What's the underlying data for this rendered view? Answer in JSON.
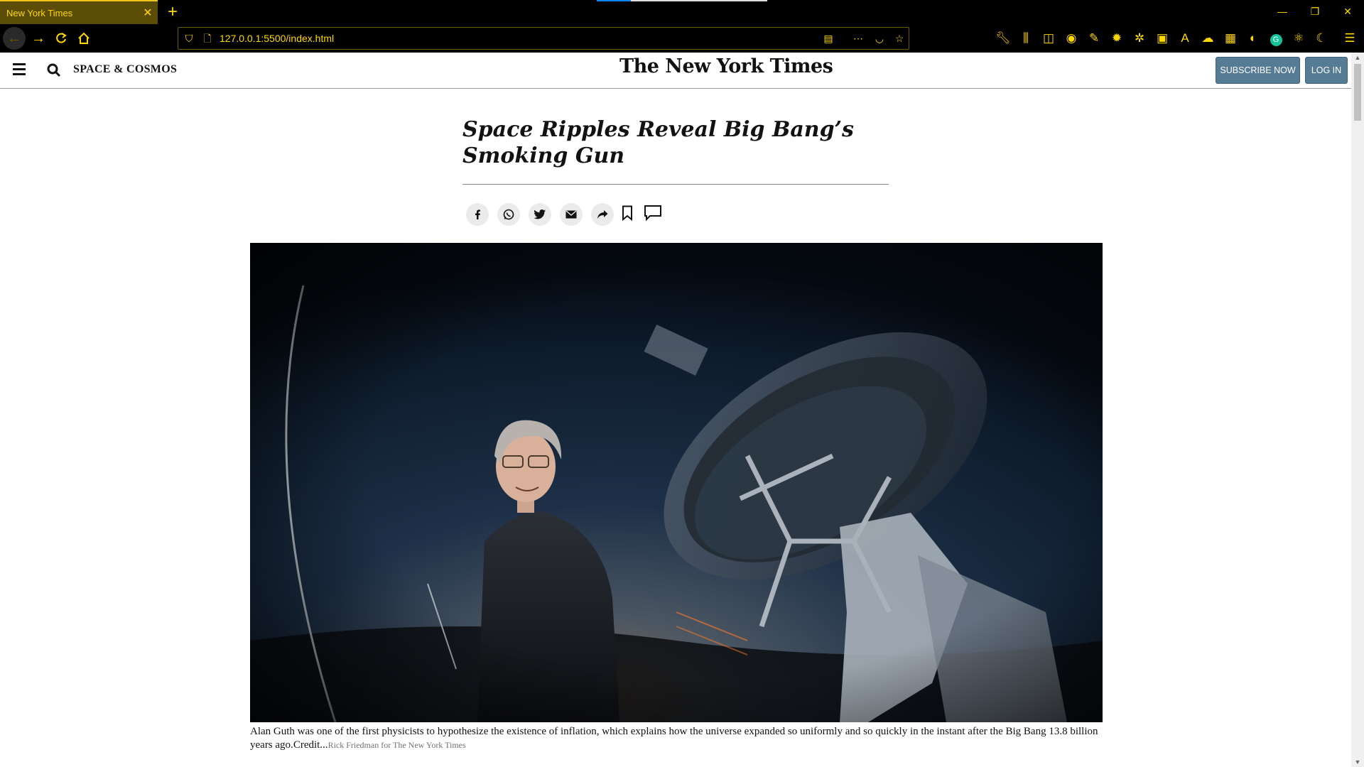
{
  "browser": {
    "tab_title": "New York Times",
    "tab_close": "✕",
    "new_tab": "+",
    "url": "127.0.0.1:5500/index.html",
    "window_controls": [
      "—",
      "❐",
      "✕"
    ],
    "load_progress": 0.2
  },
  "header": {
    "section": "SPACE & COSMOS",
    "logo": "The New York Times",
    "subscribe_label": "SUBSCRIBE NOW",
    "login_label": "LOG IN"
  },
  "article": {
    "headline": "Space Ripples Reveal Big Bang’s Smoking Gun",
    "share_icons": [
      "facebook-icon",
      "whatsapp-icon",
      "twitter-icon",
      "email-icon",
      "share-arrow-icon",
      "bookmark-icon",
      "comment-icon"
    ],
    "caption": "Alan Guth was one of the first physicists to hypothesize the existence of inflation, which explains how the universe expanded so uniformly and so quickly in the instant after the Big Bang 13.8 billion years ago.",
    "credit_label": "Credit...",
    "credit_name": "Rick Friedman for The New York Times"
  },
  "colors": {
    "chrome_accent": "#ffd800",
    "tab_bg": "#5b4d05",
    "button_blue": "#567b95"
  }
}
